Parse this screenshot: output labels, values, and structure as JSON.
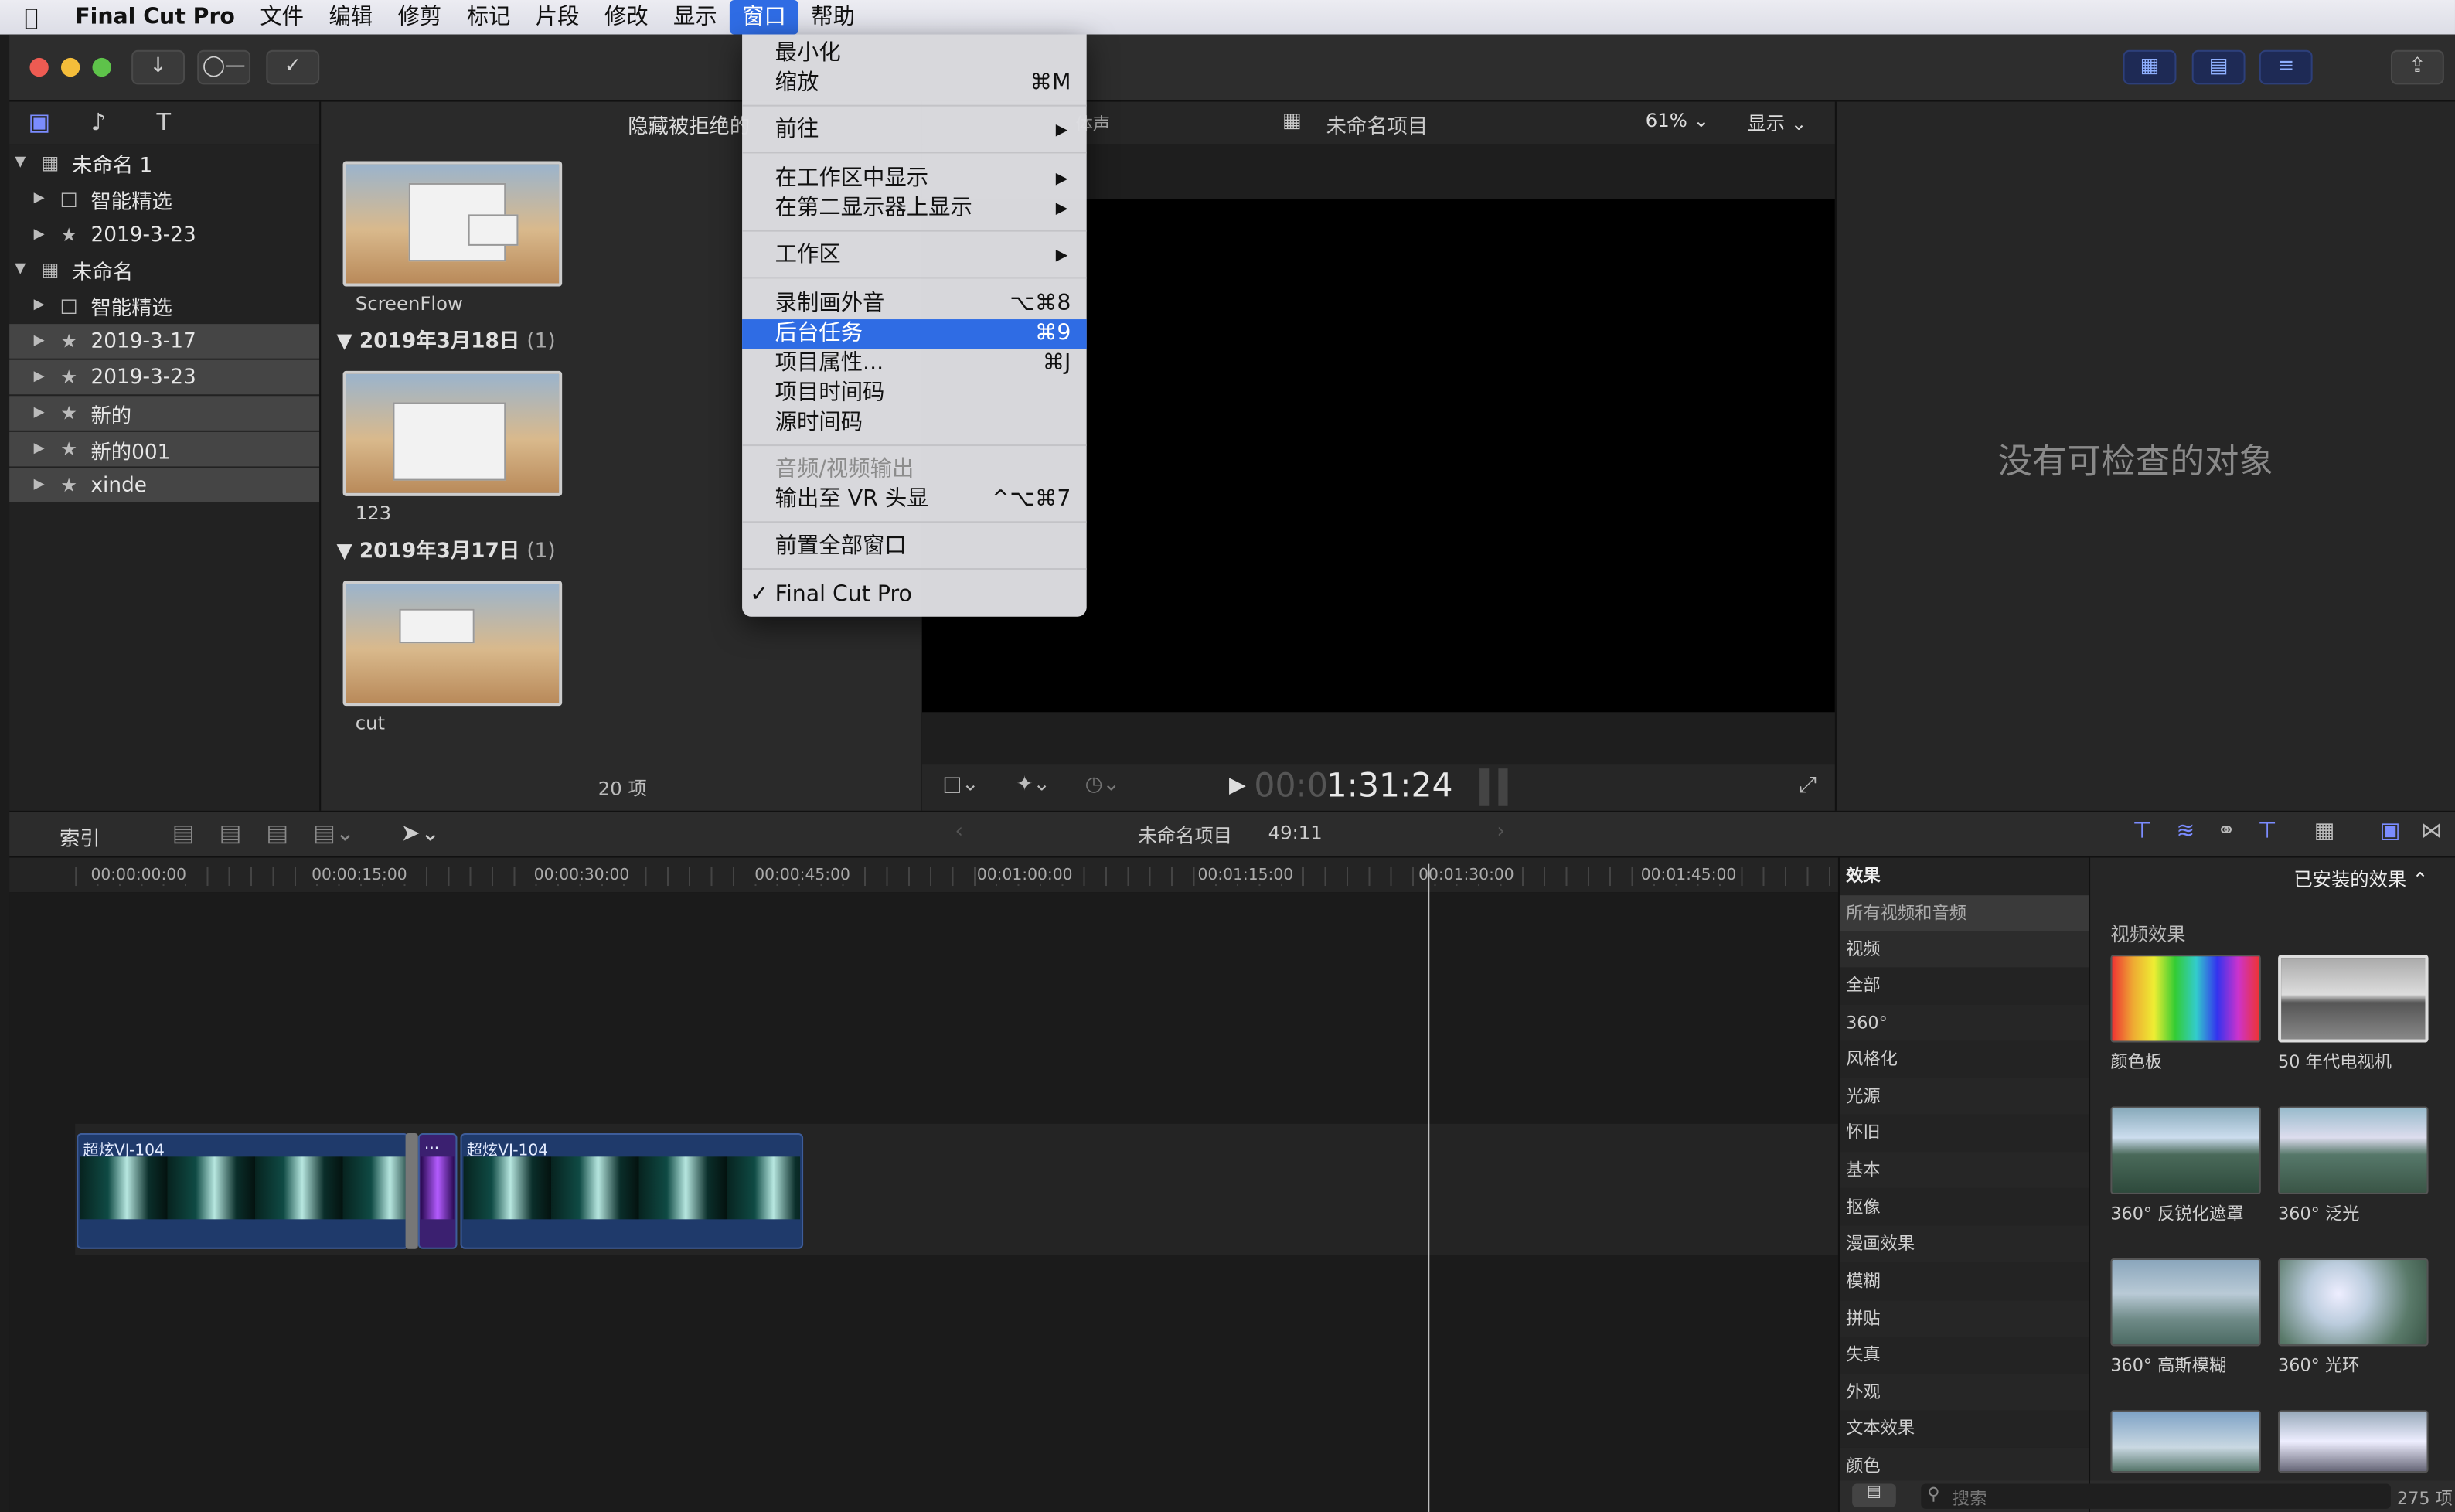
{
  "menubar": {
    "apple_icon": "apple-logo-icon",
    "app_name": "Final Cut Pro",
    "items": [
      "文件",
      "编辑",
      "修剪",
      "标记",
      "片段",
      "修改",
      "显示",
      "窗口",
      "帮助"
    ],
    "active_item": "窗口"
  },
  "window_menu": {
    "minimize": "最小化",
    "zoom": "缩放",
    "zoom_sc": "⌘M",
    "goto": "前往",
    "show_in_workspace": "在工作区中显示",
    "show_on_second_display": "在第二显示器上显示",
    "workspaces": "工作区",
    "record_voiceover": "录制画外音",
    "record_voiceover_sc": "⌥⌘8",
    "background_tasks": "后台任务",
    "background_tasks_sc": "⌘9",
    "project_properties": "项目属性...",
    "project_properties_sc": "⌘J",
    "project_timecode": "项目时间码",
    "source_timecode": "源时间码",
    "av_output": "音频/视频输出",
    "output_vr": "输出至 VR 头显",
    "output_vr_sc": "^⌥⌘7",
    "bring_all_to_front": "前置全部窗口",
    "final_cut_pro": "Final Cut Pro",
    "checkmark": "✓"
  },
  "libraries": {
    "rows": [
      {
        "label": "未命名 1",
        "tri": "▼",
        "icon": "library-icon"
      },
      {
        "label": "智能精选",
        "tri": "▶",
        "icon": "folder-icon"
      },
      {
        "label": "2019-3-23",
        "tri": "▶",
        "icon": "event-star-icon"
      },
      {
        "label": "未命名",
        "tri": "▼",
        "icon": "library-icon"
      },
      {
        "label": "智能精选",
        "tri": "▶",
        "icon": "folder-icon"
      },
      {
        "label": "2019-3-17",
        "tri": "▶",
        "icon": "event-star-icon"
      },
      {
        "label": "2019-3-23",
        "tri": "▶",
        "icon": "event-star-icon"
      },
      {
        "label": "新的",
        "tri": "▶",
        "icon": "event-star-icon"
      },
      {
        "label": "新的001",
        "tri": "▶",
        "icon": "event-star-icon"
      },
      {
        "label": "xinde",
        "tri": "▶",
        "icon": "event-star-icon"
      }
    ]
  },
  "browser": {
    "filter_label": "隐藏被拒绝的",
    "clip1": "ScreenFlow",
    "date1": "2019年3月18日",
    "date1_count": "(1)",
    "clip2": "123",
    "date2": "2019年3月17日",
    "date2_count": "(1)",
    "clip3": "cut",
    "item_count": "20 项"
  },
  "viewer": {
    "audio_label": "体声",
    "project_name": "未命名项目",
    "zoom": "61%",
    "display": "显示",
    "timecode_dim": "00:0",
    "timecode": "1:31:24"
  },
  "inspector": {
    "empty_text": "没有可检查的对象"
  },
  "timeline": {
    "index_label": "索引",
    "project_name": "未命名项目",
    "duration": "49:11",
    "ruler": [
      "00:00:00:00",
      "00:00:15:00",
      "00:00:30:00",
      "00:00:45:00",
      "00:01:00:00",
      "00:01:15:00",
      "00:01:30:00",
      "00:01:45:00"
    ],
    "clip1": "超炫VJ-104",
    "transition": "...",
    "clip2": "超炫VJ-104"
  },
  "effects": {
    "header": "效果",
    "installed": "已安装的效果 ⌃",
    "categories": [
      "所有视频和音频",
      "视频",
      "全部",
      "360°",
      "风格化",
      "光源",
      "怀旧",
      "基本",
      "抠像",
      "漫画效果",
      "模糊",
      "拼贴",
      "失真",
      "外观",
      "文本效果",
      "颜色"
    ],
    "section": "视频效果",
    "items": [
      "颜色板",
      "50 年代电视机",
      "360° 反锐化遮罩",
      "360° 泛光",
      "360° 高斯模糊",
      "360° 光环"
    ],
    "search_placeholder": "搜索",
    "count": "275 项"
  }
}
